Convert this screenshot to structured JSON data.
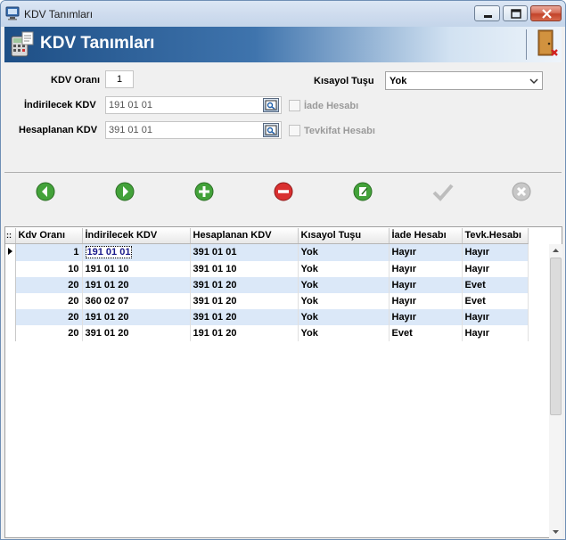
{
  "window": {
    "title": "KDV Tanımları"
  },
  "banner": {
    "title": "KDV Tanımları"
  },
  "form": {
    "kdv_orani_label": "KDV Oranı",
    "kdv_orani_value": "1",
    "indirilecek_label": "İndirilecek KDV",
    "indirilecek_value": "191 01 01",
    "hesaplanan_label": "Hesaplanan KDV",
    "hesaplanan_value": "391 01 01",
    "kisayol_label": "Kısayol Tuşu",
    "kisayol_value": "Yok",
    "iade_label": "İade Hesabı",
    "tevkifat_label": "Tevkifat Hesabı"
  },
  "toolbar": {
    "icons": [
      "prev-icon",
      "next-icon",
      "add-icon",
      "delete-icon",
      "edit-icon",
      "confirm-icon",
      "cancel-icon"
    ]
  },
  "grid": {
    "columns": [
      "Kdv Oranı",
      "İndirilecek KDV",
      "Hesaplanan KDV",
      "Kısayol Tuşu",
      "İade Hesabı",
      "Tevk.Hesabı"
    ],
    "rows": [
      [
        "1",
        "191 01 01",
        "391 01 01",
        "Yok",
        "Hayır",
        "Hayır"
      ],
      [
        "10",
        "191 01 10",
        "391 01 10",
        "Yok",
        "Hayır",
        "Hayır"
      ],
      [
        "20",
        "191 01 20",
        "391 01 20",
        "Yok",
        "Hayır",
        "Evet"
      ],
      [
        "20",
        "360 02 07",
        "391 01 20",
        "Yok",
        "Hayır",
        "Evet"
      ],
      [
        "20",
        "191 01 20",
        "391 01 20",
        "Yok",
        "Hayır",
        "Hayır"
      ],
      [
        "20",
        "391 01 20",
        "191 01 20",
        "Yok",
        "Evet",
        "Hayır"
      ]
    ]
  }
}
